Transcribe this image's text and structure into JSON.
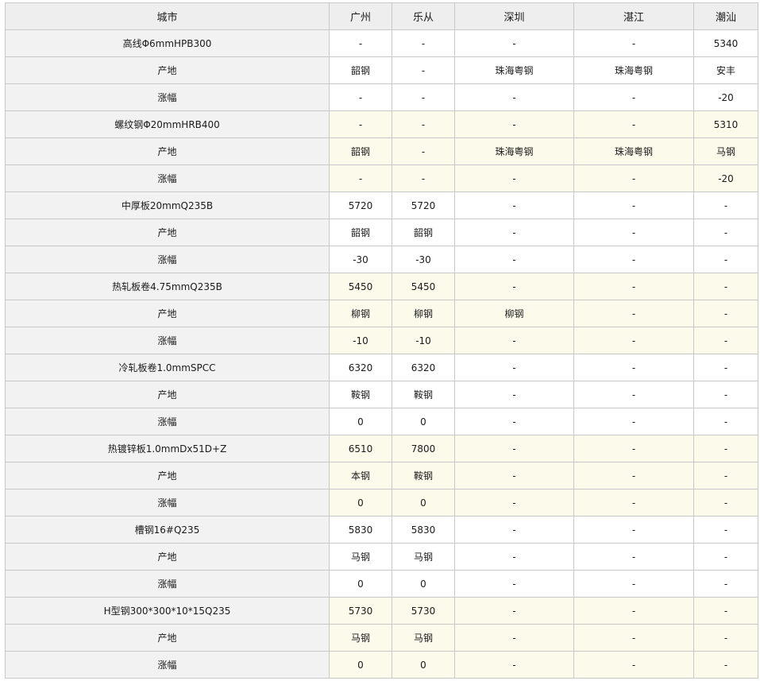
{
  "table": {
    "headers": [
      "城市",
      "广州",
      "乐从",
      "深圳",
      "湛江",
      "潮汕"
    ],
    "rows": [
      {
        "name": "高线Φ6mmHPB300",
        "values": [
          "-",
          "-",
          "-",
          "-",
          "5340"
        ],
        "shaded": false
      },
      {
        "name": "产地",
        "values": [
          "韶钢",
          "-",
          "珠海粤钢",
          "珠海粤钢",
          "安丰"
        ],
        "shaded": false
      },
      {
        "name": "涨幅",
        "values": [
          "-",
          "-",
          "-",
          "-",
          "-20"
        ],
        "shaded": false
      },
      {
        "name": "螺纹钢Φ20mmHRB400",
        "values": [
          "-",
          "-",
          "-",
          "-",
          "5310"
        ],
        "shaded": true
      },
      {
        "name": "产地",
        "values": [
          "韶钢",
          "-",
          "珠海粤钢",
          "珠海粤钢",
          "马钢"
        ],
        "shaded": true
      },
      {
        "name": "涨幅",
        "values": [
          "-",
          "-",
          "-",
          "-",
          "-20"
        ],
        "shaded": true
      },
      {
        "name": "中厚板20mmQ235B",
        "values": [
          "5720",
          "5720",
          "-",
          "-",
          "-"
        ],
        "shaded": false
      },
      {
        "name": "产地",
        "values": [
          "韶钢",
          "韶钢",
          "-",
          "-",
          "-"
        ],
        "shaded": false
      },
      {
        "name": "涨幅",
        "values": [
          "-30",
          "-30",
          "-",
          "-",
          "-"
        ],
        "shaded": false
      },
      {
        "name": "热轧板卷4.75mmQ235B",
        "values": [
          "5450",
          "5450",
          "-",
          "-",
          "-"
        ],
        "shaded": true
      },
      {
        "name": "产地",
        "values": [
          "柳钢",
          "柳钢",
          "柳钢",
          "-",
          "-"
        ],
        "shaded": true
      },
      {
        "name": "涨幅",
        "values": [
          "-10",
          "-10",
          "-",
          "-",
          "-"
        ],
        "shaded": true
      },
      {
        "name": "冷轧板卷1.0mmSPCC",
        "values": [
          "6320",
          "6320",
          "-",
          "-",
          "-"
        ],
        "shaded": false
      },
      {
        "name": "产地",
        "values": [
          "鞍钢",
          "鞍钢",
          "-",
          "-",
          "-"
        ],
        "shaded": false
      },
      {
        "name": "涨幅",
        "values": [
          "0",
          "0",
          "-",
          "-",
          "-"
        ],
        "shaded": false
      },
      {
        "name": "热镀锌板1.0mmDx51D+Z",
        "values": [
          "6510",
          "7800",
          "-",
          "-",
          "-"
        ],
        "shaded": true
      },
      {
        "name": "产地",
        "values": [
          "本钢",
          "鞍钢",
          "-",
          "-",
          "-"
        ],
        "shaded": true
      },
      {
        "name": "涨幅",
        "values": [
          "0",
          "0",
          "-",
          "-",
          "-"
        ],
        "shaded": true
      },
      {
        "name": "槽钢16#Q235",
        "values": [
          "5830",
          "5830",
          "-",
          "-",
          "-"
        ],
        "shaded": false
      },
      {
        "name": "产地",
        "values": [
          "马钢",
          "马钢",
          "-",
          "-",
          "-"
        ],
        "shaded": false
      },
      {
        "name": "涨幅",
        "values": [
          "0",
          "0",
          "-",
          "-",
          "-"
        ],
        "shaded": false
      },
      {
        "name": "H型钢300*300*10*15Q235",
        "values": [
          "5730",
          "5730",
          "-",
          "-",
          "-"
        ],
        "shaded": true
      },
      {
        "name": "产地",
        "values": [
          "马钢",
          "马钢",
          "-",
          "-",
          "-"
        ],
        "shaded": true
      },
      {
        "name": "涨幅",
        "values": [
          "0",
          "0",
          "-",
          "-",
          "-"
        ],
        "shaded": true
      }
    ]
  }
}
